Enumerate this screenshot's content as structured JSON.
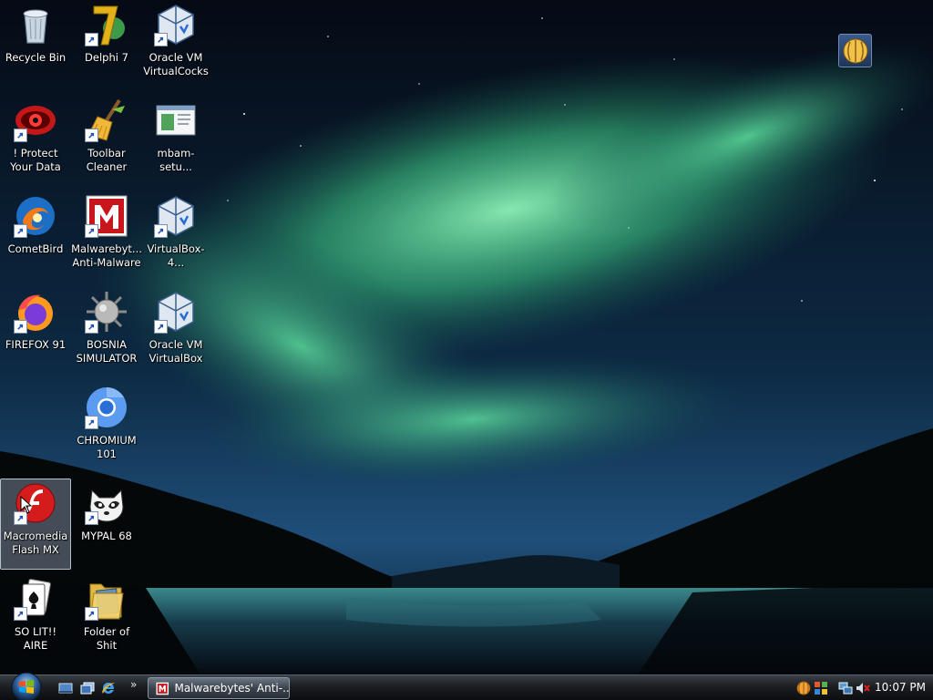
{
  "desktop": {
    "icons": [
      {
        "label": "Recycle Bin",
        "icon": "recycle-bin-icon"
      },
      {
        "label": "Delphi 7",
        "icon": "delphi-icon"
      },
      {
        "label": "Oracle VM VirtualCocks",
        "icon": "virtualbox-icon"
      },
      {
        "label": "! Protect Your Data",
        "icon": "eye-icon"
      },
      {
        "label": "Toolbar Cleaner",
        "icon": "broom-icon"
      },
      {
        "label": "mbam-setu...",
        "icon": "setup-window-icon"
      },
      {
        "label": "CometBird",
        "icon": "cometbird-icon"
      },
      {
        "label": "Malwarebyt... Anti-Malware",
        "icon": "malwarebytes-icon"
      },
      {
        "label": "VirtualBox-4...",
        "icon": "virtualbox-icon"
      },
      {
        "label": "FIREFOX 91",
        "icon": "firefox-icon"
      },
      {
        "label": "BOSNIA SIMULATOR",
        "icon": "spiked-mine-icon"
      },
      {
        "label": "Oracle VM VirtualBox",
        "icon": "virtualbox-icon"
      },
      {
        "label": "CHROMIUM 101",
        "icon": "chromium-icon"
      },
      {
        "label": "Macromedia Flash MX",
        "icon": "flash-icon"
      },
      {
        "label": "MYPAL 68",
        "icon": "raccoon-icon"
      },
      {
        "label": "SO LIT!! AIRE",
        "icon": "solitaire-icon"
      },
      {
        "label": "Folder of Shit",
        "icon": "folder-icon"
      }
    ],
    "selected_icon": "Macromedia Flash MX"
  },
  "gadget": {
    "icon": "gadget-orb-icon"
  },
  "taskbar": {
    "start_icon": "windows-orb-icon",
    "quick_launch": [
      "show-desktop-icon",
      "switch-windows-icon",
      "internet-explorer-icon"
    ],
    "quick_launch_more": "»",
    "open_window": {
      "label": "Malwarebytes' Anti-...",
      "icon": "malwarebytes-icon"
    },
    "tray_icons": [
      "orange-orb-icon",
      "network-grid-icon",
      "network-icon",
      "volume-muted-icon"
    ],
    "clock": "10:07 PM"
  },
  "colors": {
    "aurora": "#3fd089",
    "sky": "#0a1424",
    "taskbar": "#15181c",
    "selection": "#aabed7"
  }
}
